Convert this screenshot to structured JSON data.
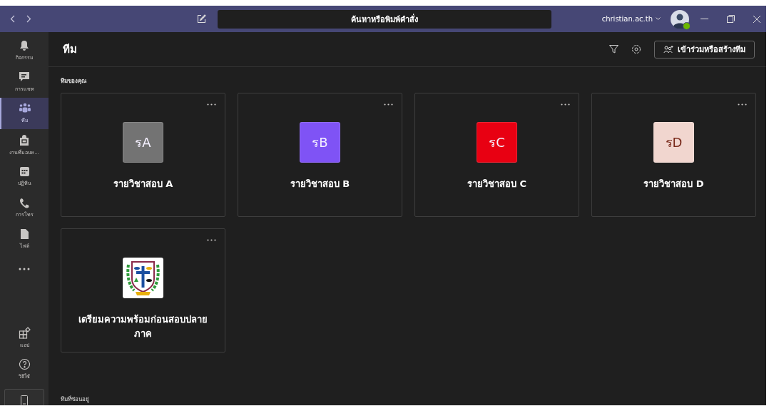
{
  "titlebar": {
    "search": {
      "placeholder": "ค้นหาหรือพิมพ์คำสั่ง"
    },
    "account": "christian.ac.th",
    "available": true
  },
  "sidebar": {
    "items": [
      {
        "label": "กิจกรรม",
        "selected": false
      },
      {
        "label": "การแชท",
        "selected": false
      },
      {
        "label": "ทีม",
        "selected": true
      },
      {
        "label": "งานที่มอบห...",
        "selected": false
      },
      {
        "label": "ปฏิทิน",
        "selected": false
      },
      {
        "label": "การโทร",
        "selected": false
      },
      {
        "label": "ไฟล์",
        "selected": false
      }
    ],
    "bottom_items": [
      {
        "label": "แอป"
      },
      {
        "label": "วิธีใช้"
      }
    ]
  },
  "header": {
    "title": "ทีม",
    "join_button": "เข้าร่วมหรือสร้างทีม"
  },
  "section_title": "ทีมของคุณ",
  "teams": [
    {
      "kind": "initials",
      "initials": "รA",
      "color": "#737373",
      "name": "รายวิชาสอบ A"
    },
    {
      "kind": "initials",
      "initials": "รB",
      "color": "#7f53f5",
      "name": "รายวิชาสอบ B"
    },
    {
      "kind": "initials",
      "initials": "รC",
      "color": "#e80012",
      "name": "รายวิชาสอบ C"
    },
    {
      "kind": "initials",
      "initials": "รD",
      "color": "#f1d6cf",
      "name": "รายวิชาสอบ D"
    },
    {
      "kind": "logo",
      "name": "เตรียมความพร้อมก่อนสอบปลายภาค"
    }
  ],
  "hidden_section_title": "ทีมที่ซ่อนอยู่"
}
